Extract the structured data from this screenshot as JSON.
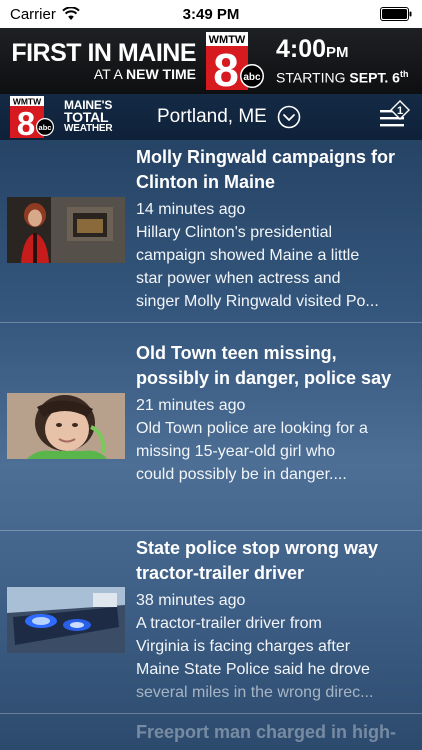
{
  "status_bar": {
    "carrier": "Carrier",
    "time": "3:49 PM"
  },
  "promo": {
    "headline_bold": "FIRST IN MAINE",
    "sub_thin": "AT A ",
    "sub_bold": "NEW TIME",
    "logo_call": "WMTW",
    "logo_channel": "8",
    "logo_network": "abc",
    "time": "4:00",
    "time_ampm": "PM",
    "start_prefix": "STARTING ",
    "start_date": "SEPT. 6",
    "start_suffix": "th"
  },
  "header": {
    "logo_call": "WMTW",
    "logo_channel": "8",
    "logo_network": "abc",
    "tagline_line1": "MAINE'S",
    "tagline_line2": "TOTAL",
    "tagline_line3": "WEATHER",
    "location": "Portland, ME",
    "menu_badge": "1"
  },
  "articles": [
    {
      "title_line1": "Molly Ringwald campaigns for",
      "title_line2": "Clinton in Maine",
      "time": "14 minutes ago",
      "summary_line1": "Hillary Clinton's presidential",
      "summary_line2": "campaign showed Maine a little",
      "summary_line3": "star power when actress and",
      "summary_line4": "singer Molly Ringwald visited Po..."
    },
    {
      "title_line1": "Old Town teen missing,",
      "title_line2": "possibly in danger, police say",
      "time": "21 minutes ago",
      "summary_line1": "Old Town police are looking for a",
      "summary_line2": "missing 15-year-old girl who",
      "summary_line3": "could possibly be in danger...."
    },
    {
      "title_line1": "State police stop wrong way",
      "title_line2": "tractor-trailer driver",
      "time": "38 minutes ago",
      "summary_line1": "A tractor-trailer driver from",
      "summary_line2": "Virginia is facing charges after",
      "summary_line3": "Maine State Police said he drove",
      "summary_line4": "several miles in the wrong direc..."
    },
    {
      "title_line1": "Freeport man charged in high-"
    }
  ]
}
